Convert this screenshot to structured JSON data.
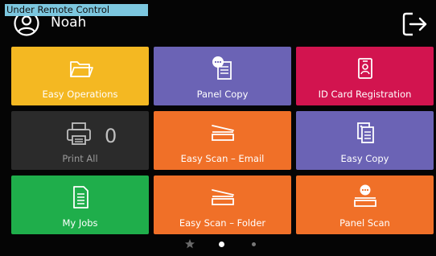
{
  "remote_banner": "Under Remote Control",
  "user": {
    "name": "Noah",
    "icon": "user-circle-icon"
  },
  "logout": {
    "icon": "logout-icon"
  },
  "tiles": [
    {
      "label": "Easy Operations",
      "icon": "folder-icon",
      "color": "#f4b822"
    },
    {
      "label": "Panel Copy",
      "icon": "panel-copy-icon",
      "color": "#6b63b5"
    },
    {
      "label": "ID Card Registration",
      "icon": "id-card-icon",
      "color": "#d2144f"
    },
    {
      "label": "Print All",
      "icon": "printer-icon",
      "color": "#2b2b2b",
      "count": "0"
    },
    {
      "label": "Easy Scan – Email",
      "icon": "scanner-icon",
      "color": "#f07028"
    },
    {
      "label": "Easy Copy",
      "icon": "copy-documents-icon",
      "color": "#6b63b5"
    },
    {
      "label": "My Jobs",
      "icon": "document-list-icon",
      "color": "#1fae4b"
    },
    {
      "label": "Easy Scan – Folder",
      "icon": "scanner-icon",
      "color": "#f07028"
    },
    {
      "label": "Panel Scan",
      "icon": "panel-scan-icon",
      "color": "#f07028"
    }
  ],
  "pager": {
    "pages": 3,
    "current": 2
  }
}
